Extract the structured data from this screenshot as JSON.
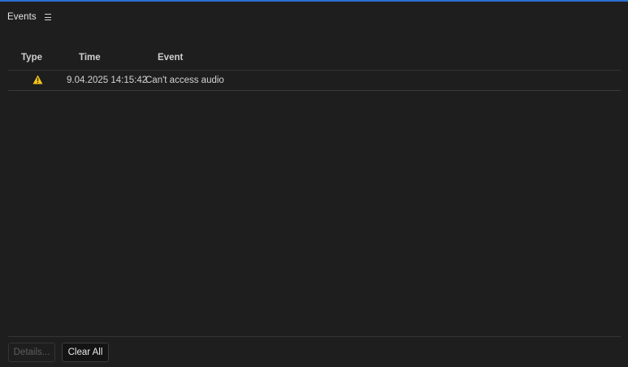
{
  "panel": {
    "title": "Events",
    "menu_icon": "hamburger-menu-icon"
  },
  "table": {
    "columns": {
      "type": "Type",
      "time": "Time",
      "event": "Event"
    },
    "rows": [
      {
        "type_icon": "warning-icon",
        "type_color": "#f5c518",
        "time": "9.04.2025 14:15:42",
        "event": "Can't access audio"
      }
    ]
  },
  "footer": {
    "details_label": "Details...",
    "clear_all_label": "Clear All"
  },
  "colors": {
    "background": "#1e1e1e",
    "accent_top_border": "#2d6fd1",
    "warning": "#f5c518"
  }
}
